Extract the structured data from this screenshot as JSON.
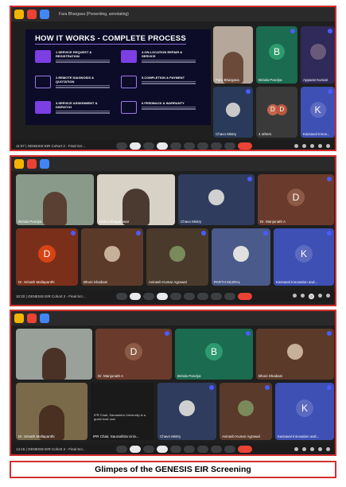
{
  "shots": [
    {
      "time": "11:07",
      "meeting": "GENESIS EIR Cohort 2 - Final Scr...",
      "presenting": "Fara Bhargava (Presenting, annotating)",
      "slide": {
        "title": "HOW IT WORKS - COMPLETE PROCESS",
        "steps": [
          {
            "title": "1.SERVICE REQUEST & REGISTRATION"
          },
          {
            "title": "2.REMOTE DIAGNOSIS & QUOTATION"
          },
          {
            "title": "3.SERVICE ASSIGNMENT & DISPATCH"
          },
          {
            "title": "4.ON-LOCATION REPAIR & SERVICE"
          },
          {
            "title": "5.COMPLETION & PAYMENT"
          },
          {
            "title": "6.FEEDBACK & WARRANTY"
          }
        ]
      },
      "tiles": [
        "Fara Bhargava",
        "Brinda Pandya",
        "Apparat Kumari",
        "Chavo Mistry",
        "4 others",
        "Karnaval Innov..."
      ],
      "avatars": [
        "B",
        "D",
        "D",
        "K"
      ]
    },
    {
      "time": "10:32",
      "meeting": "GENESIS EIR Cohort 2 - Final Scr...",
      "tiles": [
        "Brinda Pandya",
        "Rahul Dhagamwar",
        "Chavo Mistry",
        "Dr. Manjunath A",
        "Dr. Srinath Mallapanthi",
        "Bhoni Shaibani",
        "Avinash Kumar Agrawal",
        "PARTH KEJRAL",
        "Karnaval Innovation and..."
      ],
      "avatars": [
        "D",
        "D",
        "K"
      ]
    },
    {
      "time": "14:15",
      "meeting": "GENESIS EIR Cohort 2 - Final Scr...",
      "tiles": [
        "",
        "Dr. Manjunath A",
        "Brinda Pandya",
        "Bhoni Shaibani",
        "Dr. Srinath Mallapanthi",
        "IPR Chair, Saurashtra Univ...",
        "Chavo Mistry",
        "Avinash Kumar Agrawal",
        "Karnaval Innovation and..."
      ],
      "tooltip": "IPR Chair, Saurashtra University is a guest host now",
      "avatars": [
        "D",
        "B",
        "K"
      ]
    }
  ],
  "caption": "Glimpes of the GENESIS EIR Screening",
  "colors": {
    "accent_border": "#d32f2f",
    "end_call": "#ea4335",
    "slide_bg": "#0c0b28",
    "slide_accent": "#7b3fe4"
  }
}
